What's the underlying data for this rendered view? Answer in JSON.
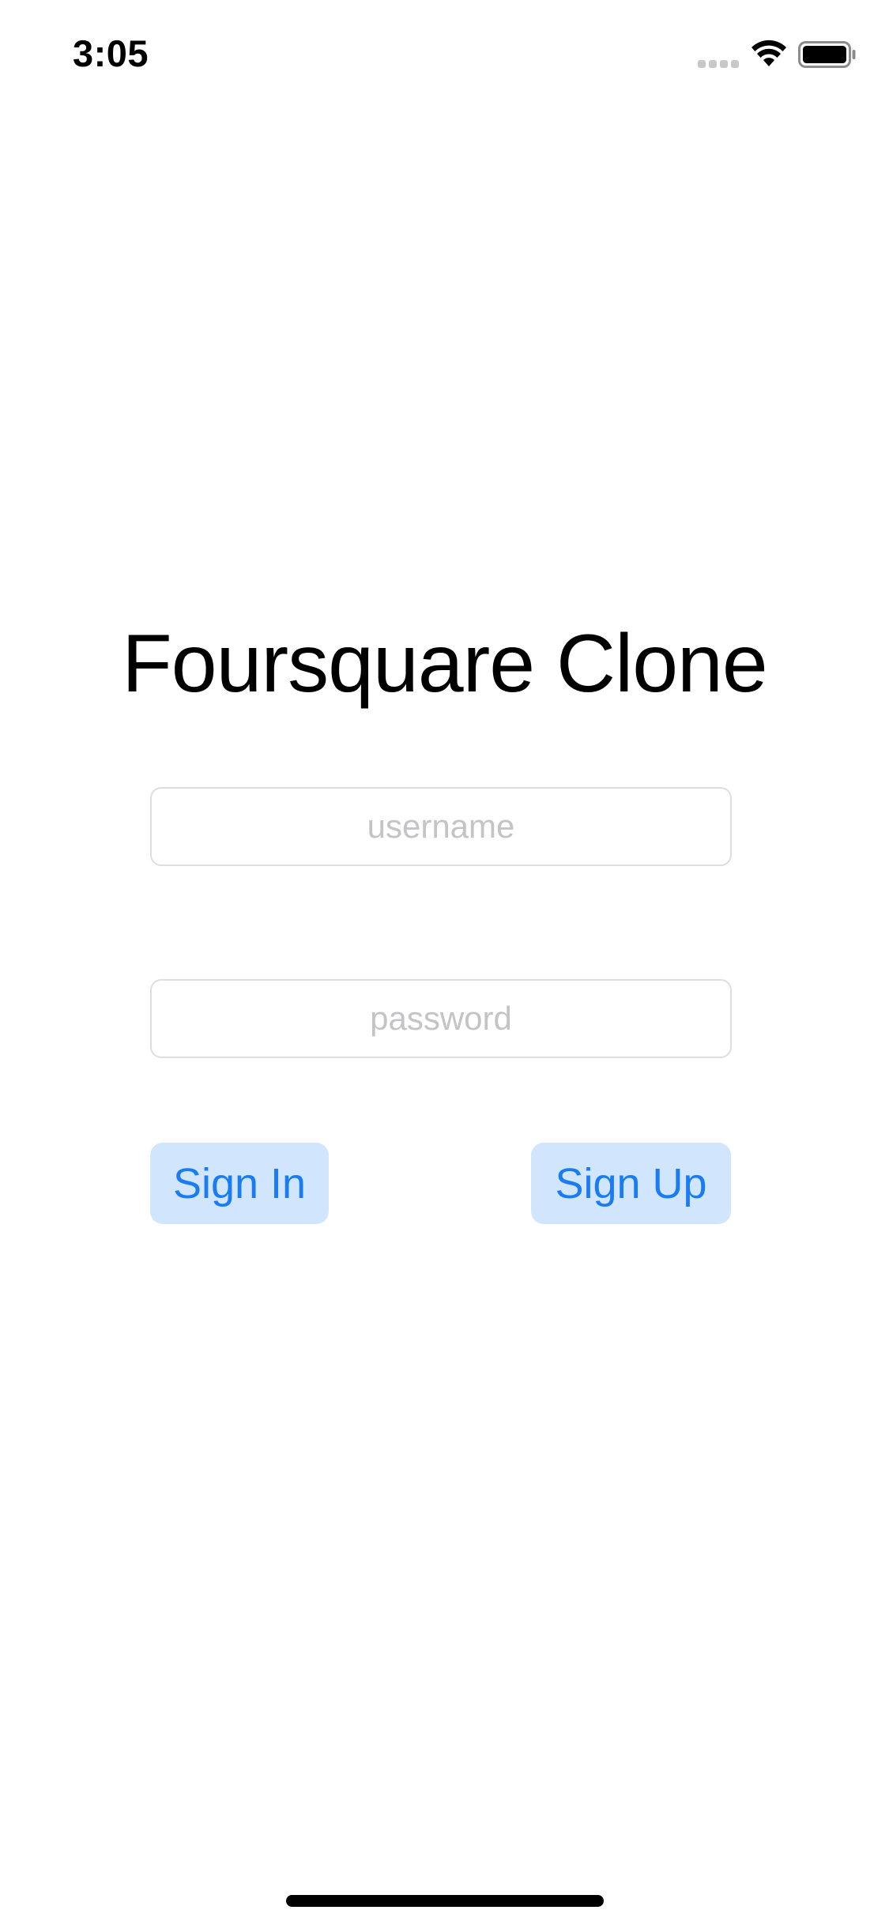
{
  "status_bar": {
    "time": "3:05",
    "icons": [
      "signal-dots-icon",
      "wifi-icon",
      "battery-icon"
    ]
  },
  "app": {
    "title": "Foursquare Clone"
  },
  "form": {
    "username_placeholder": "username",
    "username_value": "",
    "password_placeholder": "password",
    "password_value": ""
  },
  "buttons": {
    "sign_in_label": "Sign In",
    "sign_up_label": "Sign Up"
  },
  "colors": {
    "accent": "#1a7cf4",
    "button_background": "#d1e6fd",
    "field_border": "#dedede",
    "placeholder": "#c4c4c6"
  }
}
